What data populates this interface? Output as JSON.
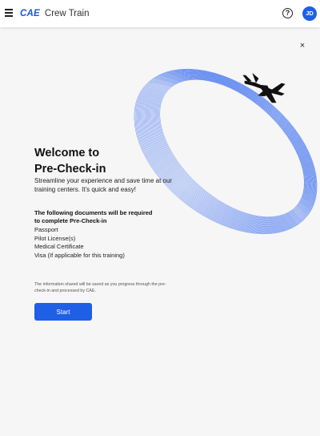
{
  "topbar": {
    "brand_logo": "CAE",
    "brand_name": "Crew Train",
    "help_icon_glyph": "?",
    "avatar_initials": "JD"
  },
  "dialog": {
    "close_glyph": "×",
    "title_line1": "Welcome to",
    "title_line2": "Pre-Check-in",
    "subtitle": "Streamline your experience and save time at our training centers. It's quick and easy!",
    "requirements_heading_line1": "The following documents will be required",
    "requirements_heading_line2": "to complete Pre-Check-in",
    "documents": [
      "Passport",
      "Pilot License(s)",
      "Medical Certificate",
      "Visa (If applicable for this training)"
    ],
    "notice": "The information shared will be saved as you progress through the pre-check-in and processed by CAE.",
    "start_label": "Start"
  },
  "colors": {
    "accent": "#1f5fe6",
    "background": "#f6f6f6",
    "ring_line": "#3a6df0"
  },
  "icons": [
    "menu-icon",
    "help-circle-icon",
    "close-icon",
    "airplane-icon"
  ]
}
